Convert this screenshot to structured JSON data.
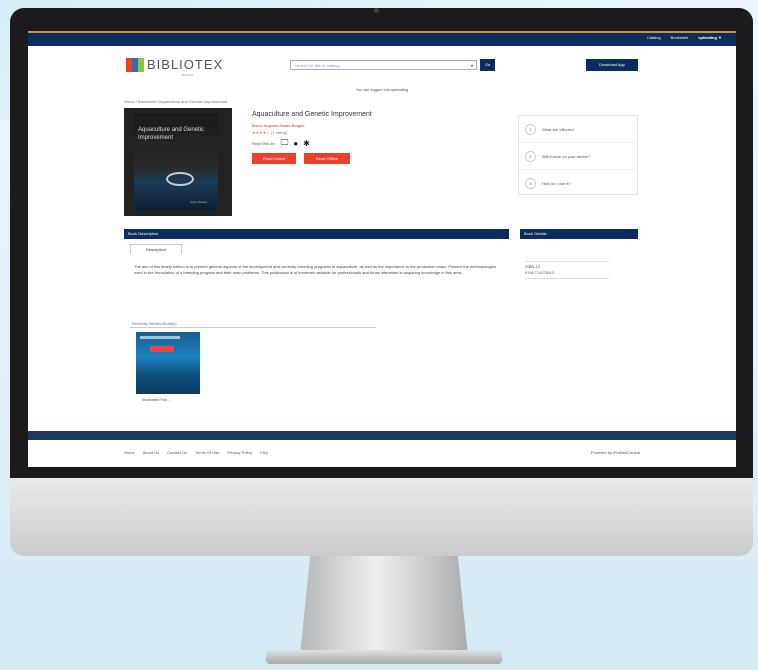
{
  "nav": {
    "links": [
      "Catalog",
      "Bookshelf",
      "spleading ▼"
    ]
  },
  "logo": {
    "name": "BIBLIOTEX",
    "sub": "DIGITAL",
    "colors": [
      "#e8402a",
      "#2f6db5",
      "#8cc63f"
    ]
  },
  "search": {
    "placeholder": "Search for title or catalog",
    "go": "Go"
  },
  "download_label": "Download App",
  "logged_in": "You are logged into spleading",
  "breadcrumb": "Home / Bookshelf / Aquaculture and Genetic Improvement",
  "book": {
    "cover_title": "Aquaculture and Genetic Improvement",
    "cover_publisher": "Open Nature",
    "title": "Aquaculture and Genetic Improvement",
    "author": "Bruno Augusto Amato Borges",
    "stars": "★★★★☆",
    "rating_text": "(1 rating)",
    "read_on": "Read this on:",
    "read_online": "Read Online",
    "read_offline": "Read Offline"
  },
  "faq": [
    {
      "n": "1",
      "q": "What are eBooks?"
    },
    {
      "n": "2",
      "q": "Will it work on your device?"
    },
    {
      "n": "3",
      "q": "How do I use it?"
    }
  ],
  "sections": {
    "description": "Book Description",
    "details": "Book Details"
  },
  "tab_description": "Description",
  "description": "The aim of this timely edition is to present general aspects of the development and currently breeding programs in aquaculture, as well as the importance to the production chain. Present the methodologies used in the formulation of a breeding program and their main problems. This publication is of immense valuable for professionals and those interested in acquiring knowledge in this area.",
  "details": {
    "isbn_label": "ISBN-13",
    "isbn": "9781774072613"
  },
  "recent": {
    "header": "Recently Viewed Book(s)",
    "caption": "Illustrated Fan..."
  },
  "footer": {
    "links": [
      "Home",
      "About Us",
      "Contact Us",
      "Terms Of Use",
      "Privacy Policy",
      "FAQ"
    ],
    "powered": "Powered by iPublishCentral"
  },
  "colors": {
    "navy": "#0b2c5e",
    "accent_red": "#e8402a",
    "gold": "#c99a2e"
  }
}
